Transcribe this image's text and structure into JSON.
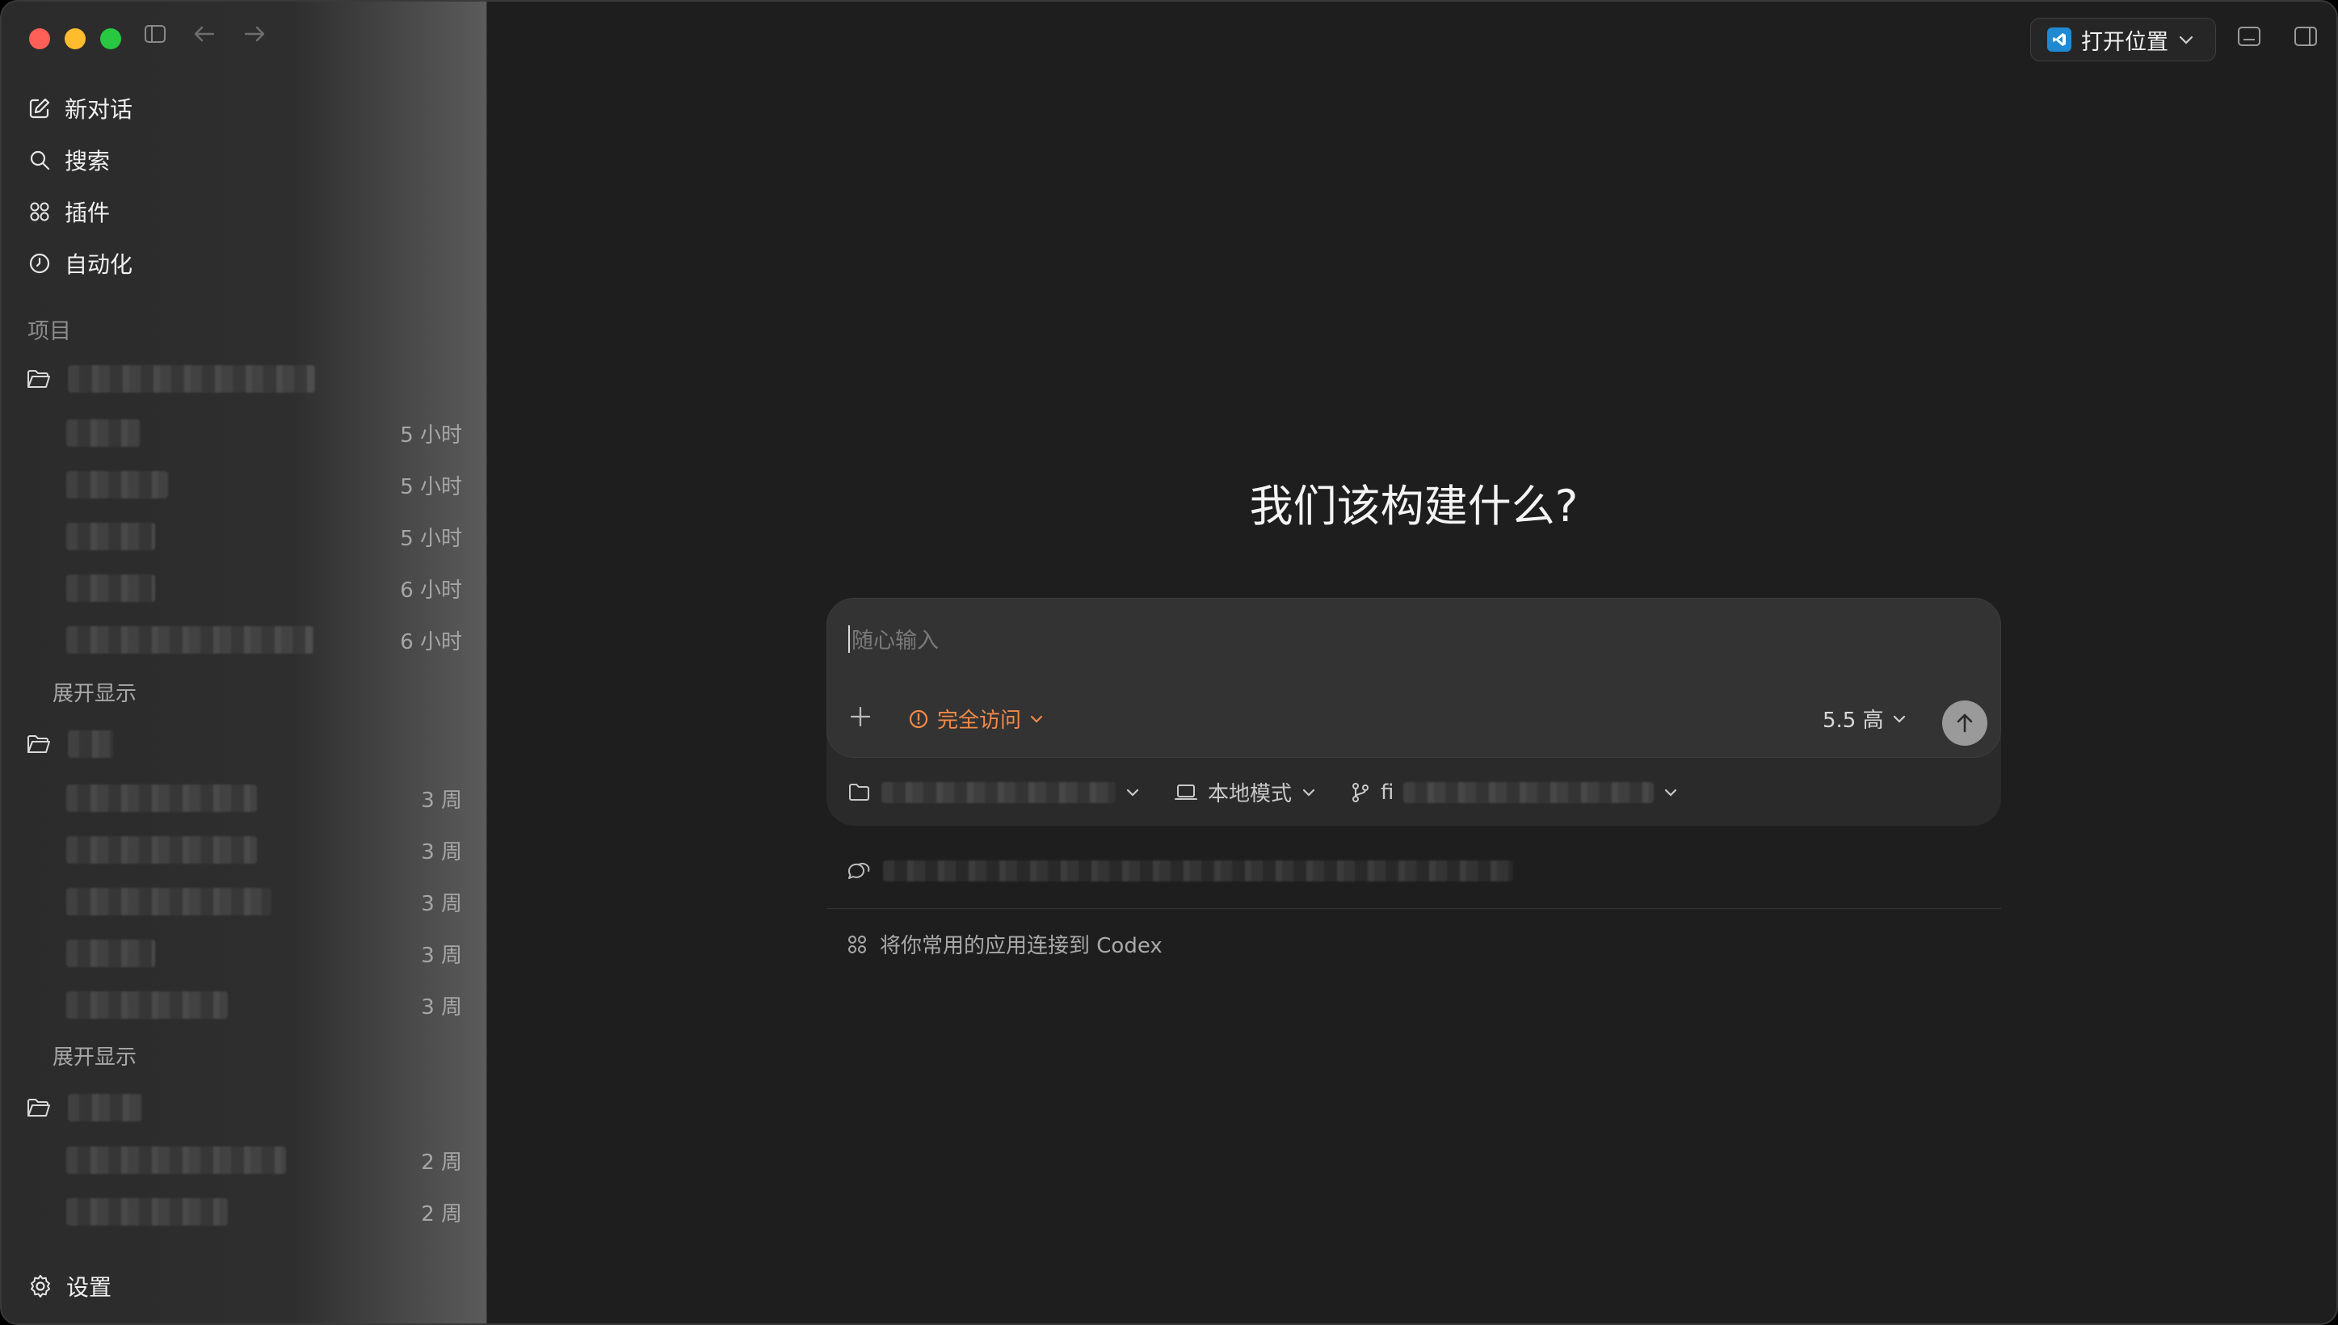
{
  "sidebar": {
    "nav": [
      {
        "label": "新对话",
        "icon": "edit-icon"
      },
      {
        "label": "搜索",
        "icon": "search-icon"
      },
      {
        "label": "插件",
        "icon": "plugins-icon"
      },
      {
        "label": "自动化",
        "icon": "clock-icon"
      }
    ],
    "section_label": "项目",
    "project1": {
      "threads": [
        {
          "time": "5 小时"
        },
        {
          "time": "5 小时"
        },
        {
          "time": "5 小时"
        },
        {
          "time": "6 小时"
        },
        {
          "time": "6 小时"
        }
      ],
      "expand": "展开显示"
    },
    "project2": {
      "threads": [
        {
          "time": "3 周"
        },
        {
          "time": "3 周"
        },
        {
          "time": "3 周"
        },
        {
          "time": "3 周"
        },
        {
          "time": "3 周"
        }
      ],
      "expand": "展开显示"
    },
    "project3": {
      "threads": [
        {
          "time": "2 周"
        },
        {
          "time": "2 周"
        }
      ]
    },
    "settings_label": "设置"
  },
  "toolbar": {
    "open_location_label": "打开位置"
  },
  "main": {
    "headline": "我们该构建什么?",
    "composer": {
      "placeholder": "随心输入",
      "access_label": "完全访问",
      "model_label": "5.5 高"
    },
    "bottom_bar": {
      "mode_label": "本地模式",
      "branch_prefix": "fi"
    },
    "connect_label": "将你常用的应用连接到 Codex"
  },
  "colors": {
    "accent_orange": "#f08a4a",
    "background": "#1e1e1e",
    "sidebar": "#2b2b2b"
  }
}
